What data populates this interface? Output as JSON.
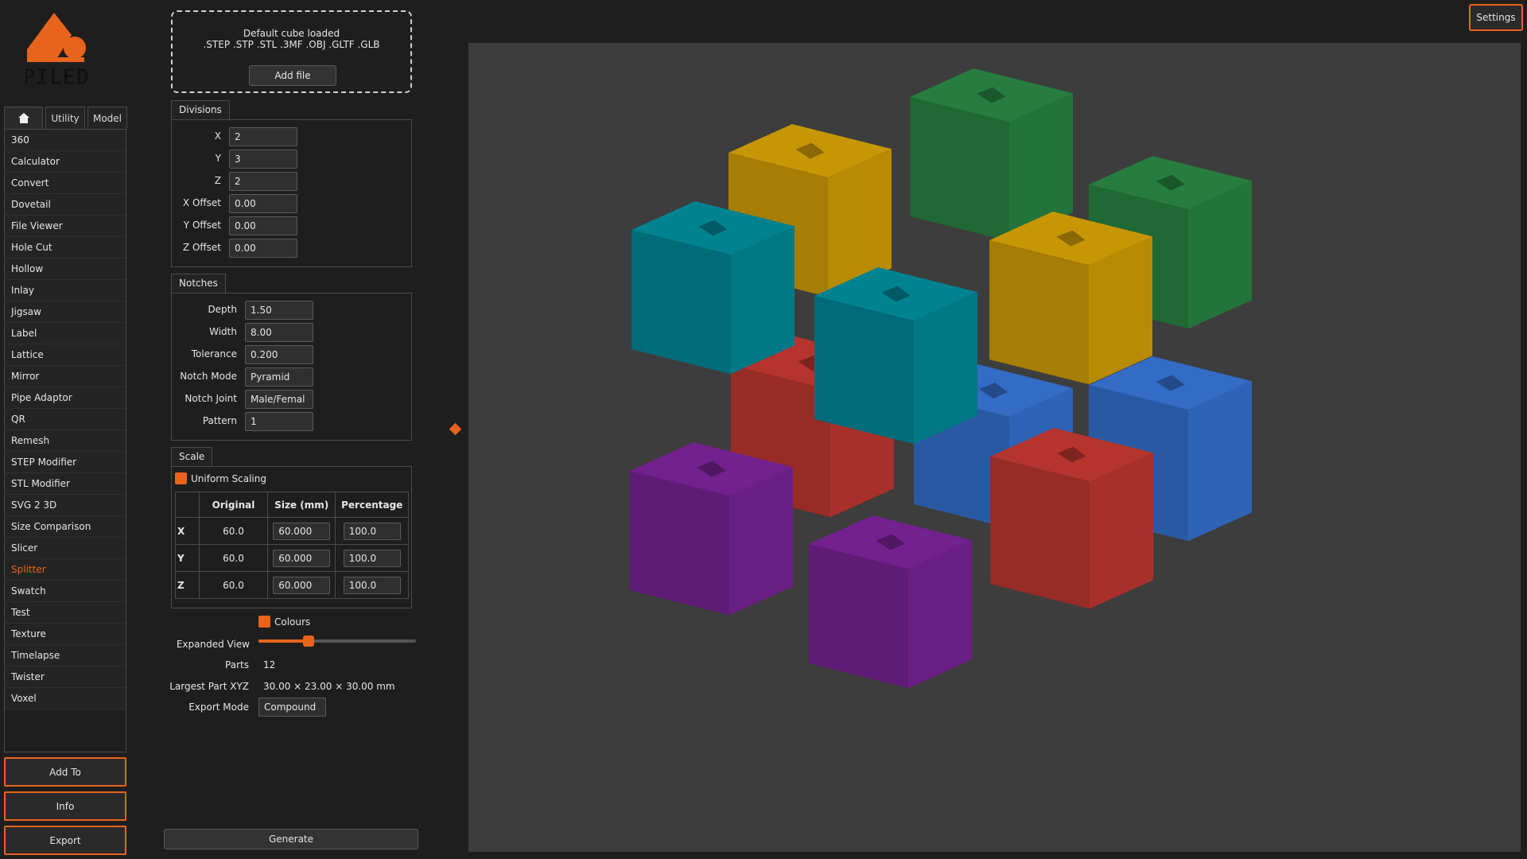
{
  "app": {
    "logo_text": "PILED"
  },
  "nav_tabs": [
    {
      "label": "",
      "icon": "home-icon",
      "active": true
    },
    {
      "label": "Utility"
    },
    {
      "label": "Model"
    }
  ],
  "tools": [
    "360",
    "Calculator",
    "Convert",
    "Dovetail",
    "File Viewer",
    "Hole Cut",
    "Hollow",
    "Inlay",
    "Jigsaw",
    "Label",
    "Lattice",
    "Mirror",
    "Pipe Adaptor",
    "QR",
    "Remesh",
    "STEP Modifier",
    "STL Modifier",
    "SVG 2 3D",
    "Size Comparison",
    "Slicer",
    "Splitter",
    "Swatch",
    "Test",
    "Texture",
    "Timelapse",
    "Twister",
    "Voxel"
  ],
  "selected_tool": "Splitter",
  "side_buttons": {
    "add_to": "Add To",
    "info": "Info",
    "export": "Export"
  },
  "file_drop": {
    "status": "Default cube loaded",
    "formats": ".STEP .STP .STL .3MF .OBJ .GLTF .GLB",
    "add_file": "Add file"
  },
  "divisions": {
    "title": "Divisions",
    "fields": [
      {
        "label": "X",
        "value": "2"
      },
      {
        "label": "Y",
        "value": "3"
      },
      {
        "label": "Z",
        "value": "2"
      },
      {
        "label": "X Offset",
        "value": "0.00"
      },
      {
        "label": "Y Offset",
        "value": "0.00"
      },
      {
        "label": "Z Offset",
        "value": "0.00"
      }
    ]
  },
  "notches": {
    "title": "Notches",
    "fields": [
      {
        "label": "Depth",
        "value": "1.50"
      },
      {
        "label": "Width",
        "value": "8.00"
      },
      {
        "label": "Tolerance",
        "value": "0.200"
      },
      {
        "label": "Notch Mode",
        "value": "Pyramid"
      },
      {
        "label": "Notch Joint",
        "value": "Male/Femal"
      },
      {
        "label": "Pattern",
        "value": "1"
      }
    ]
  },
  "scale": {
    "title": "Scale",
    "uniform_label": "Uniform Scaling",
    "headers": [
      "Original",
      "Size (mm)",
      "Percentage"
    ],
    "rows": [
      {
        "axis": "X",
        "original": "60.0",
        "size": "60.000",
        "percent": "100.0"
      },
      {
        "axis": "Y",
        "original": "60.0",
        "size": "60.000",
        "percent": "100.0"
      },
      {
        "axis": "Z",
        "original": "60.0",
        "size": "60.000",
        "percent": "100.0"
      }
    ]
  },
  "output": {
    "colours_label": "Colours",
    "expanded_view_label": "Expanded View",
    "expanded_view_level": 0.32,
    "parts_label": "Parts",
    "parts_value": "12",
    "largest_label": "Largest Part XYZ",
    "largest_value": "30.00 × 23.00 × 30.00 mm",
    "export_mode_label": "Export Mode",
    "export_mode_value": "Compound"
  },
  "generate_label": "Generate",
  "settings_label": "Settings",
  "colors": {
    "accent": "#e8641c",
    "green": "#23743a",
    "yellow": "#b88b05",
    "teal": "#007886",
    "red": "#a8302a",
    "blue": "#2f63b6",
    "purple": "#6a1f84"
  }
}
